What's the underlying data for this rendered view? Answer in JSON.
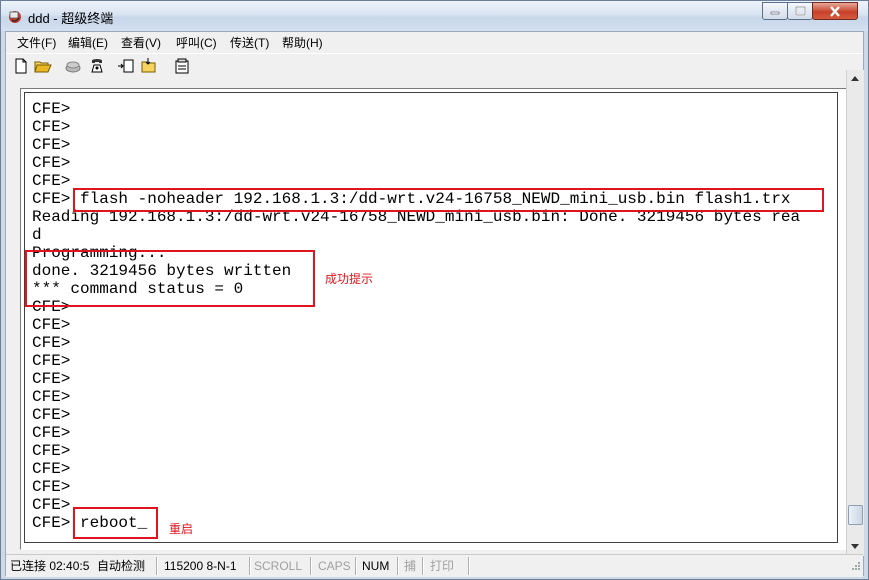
{
  "window": {
    "title": "ddd - 超级终端",
    "controls": {
      "minimize_icon": "minimize-icon",
      "maximize_icon": "maximize-icon",
      "close_icon": "close-icon"
    }
  },
  "menu": [
    "文件(F)",
    "编辑(E)",
    "查看(V)",
    "呼叫(C)",
    "传送(T)",
    "帮助(H)"
  ],
  "toolbar": {
    "icons": [
      "new-file-icon",
      "open-folder-icon",
      "disconnect-icon",
      "call-icon",
      "send-file-icon",
      "receive-file-icon",
      "properties-icon"
    ]
  },
  "terminal": {
    "lines": [
      "CFE>",
      "CFE>",
      "CFE>",
      "CFE>",
      "CFE>",
      "CFE> flash -noheader 192.168.1.3:/dd-wrt.v24-16758_NEWD_mini_usb.bin flash1.trx",
      "Reading 192.168.1.3:/dd-wrt.v24-16758_NEWD_mini_usb.bin: Done. 3219456 bytes rea",
      "d",
      "Programming...",
      "done. 3219456 bytes written",
      "*** command status = 0",
      "CFE>",
      "CFE>",
      "CFE>",
      "CFE>",
      "CFE>",
      "CFE>",
      "CFE>",
      "CFE>",
      "CFE>",
      "CFE>",
      "CFE>",
      "CFE>",
      "CFE> reboot_"
    ],
    "annotations": {
      "success_note": "成功提示",
      "reboot_note": "重启"
    },
    "highlight_color": "#e0141e"
  },
  "status": {
    "connection": "已连接 02:40:5",
    "detect": "自动检测",
    "port": "115200 8-N-1",
    "scroll": "SCROLL",
    "caps": "CAPS",
    "num": "NUM",
    "capture": "捕",
    "print": "打印"
  }
}
